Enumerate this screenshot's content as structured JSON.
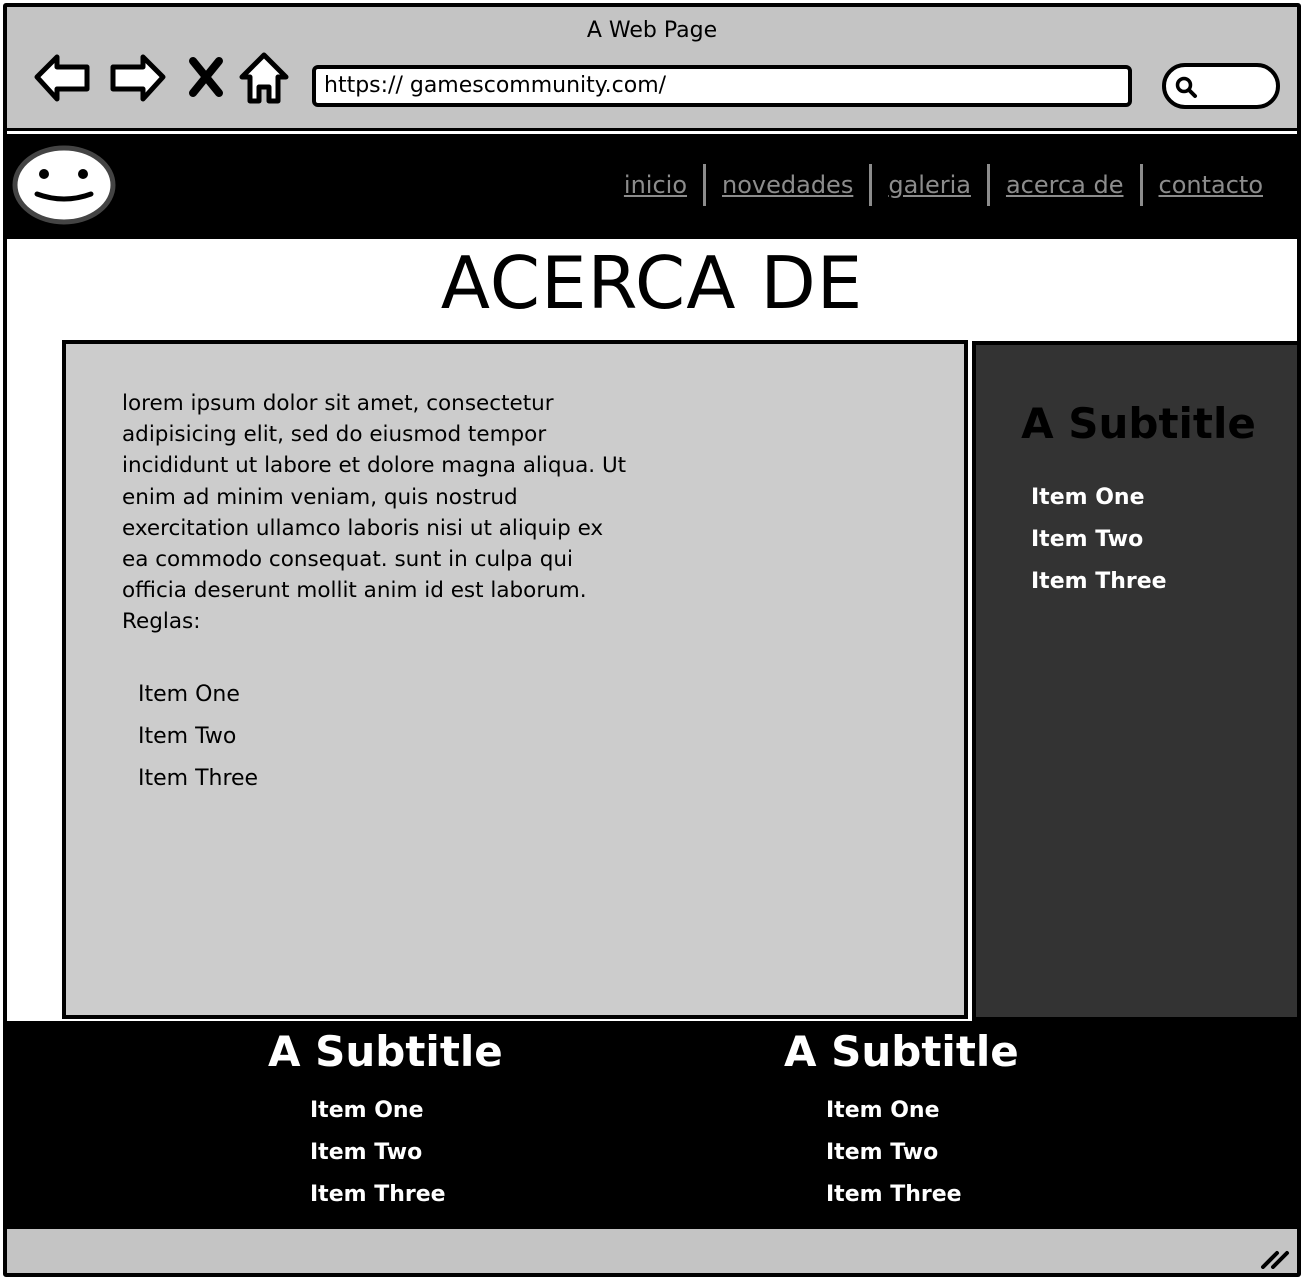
{
  "window": {
    "title": "A Web Page"
  },
  "browser": {
    "url": "https:// gamescommunity.com/",
    "icons": [
      "back-arrow-icon",
      "forward-arrow-icon",
      "close-x-icon",
      "home-icon",
      "search-icon"
    ]
  },
  "header": {
    "logo_icon": "smiley-face-icon",
    "nav": [
      {
        "label": "inicio"
      },
      {
        "label": "novedades"
      },
      {
        "label": "galeria"
      },
      {
        "label": "acerca de"
      },
      {
        "label": "contacto"
      }
    ]
  },
  "main": {
    "title": "ACERCA DE",
    "body": "lorem ipsum dolor sit amet, consectetur\nadipisicing elit, sed do eiusmod tempor\nincididunt ut labore et dolore magna aliqua. Ut\nenim ad minim veniam, quis nostrud\nexercitation ullamco laboris nisi ut aliquip ex\nea commodo consequat.  sunt in culpa qui\nofficia deserunt mollit anim id est laborum.\nReglas:",
    "list": [
      "Item One",
      "Item Two",
      "Item Three"
    ]
  },
  "sidebar": {
    "title": "A Subtitle",
    "items": [
      "Item One",
      "Item Two",
      "Item Three"
    ]
  },
  "footer": {
    "columns": [
      {
        "title": "A Subtitle",
        "items": [
          "Item One",
          "Item Two",
          "Item Three"
        ]
      },
      {
        "title": "A Subtitle",
        "items": [
          "Item One",
          "Item Two",
          "Item Three"
        ]
      }
    ]
  },
  "colors": {
    "chrome": "#c4c4c4",
    "header_bg": "#000000",
    "nav_link": "#8c8c8c",
    "content_bg": "#cccccc",
    "sidebar_bg": "#333333",
    "footer_bg": "#000000"
  }
}
